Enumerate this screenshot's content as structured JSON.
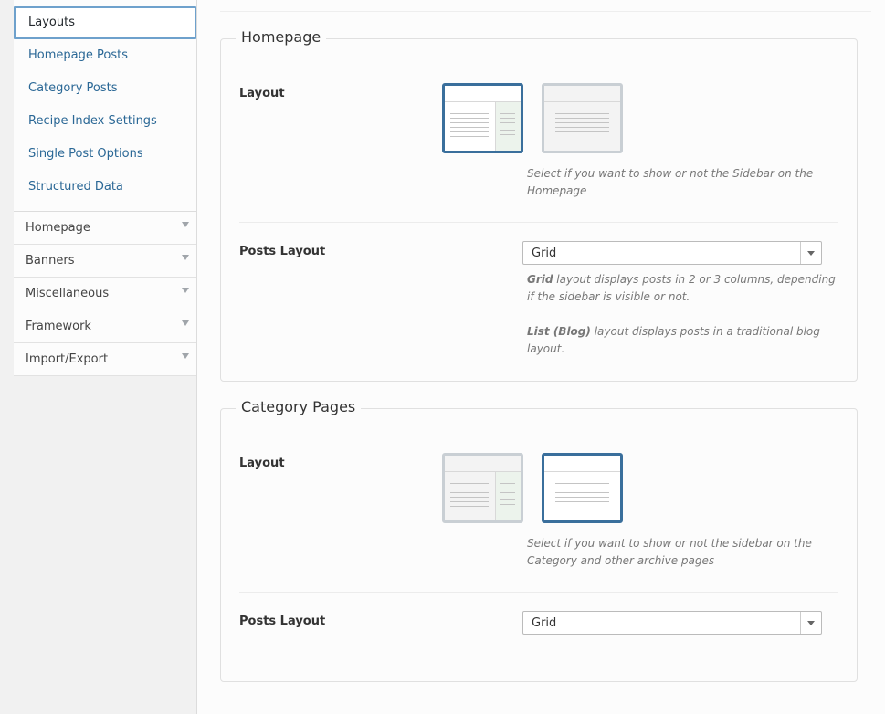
{
  "sidebar": {
    "sub_items": [
      "Layouts",
      "Homepage Posts",
      "Category Posts",
      "Recipe Index Settings",
      "Single Post Options",
      "Structured Data"
    ],
    "groups": [
      "Homepage",
      "Banners",
      "Miscellaneous",
      "Framework",
      "Import/Export"
    ]
  },
  "homepage": {
    "title": "Homepage",
    "layout_label": "Layout",
    "layout_help": "Select if you want to show or not the Sidebar on the Homepage",
    "layout_selected": "with-sidebar",
    "posts_layout_label": "Posts Layout",
    "posts_layout_value": "Grid",
    "grid_help_bold": "Grid",
    "grid_help_text": " layout displays posts in 2 or 3 columns, depending if the sidebar is visible or not.",
    "list_help_bold": "List (Blog)",
    "list_help_text": " layout displays posts in a traditional blog layout."
  },
  "category": {
    "title": "Category Pages",
    "layout_label": "Layout",
    "layout_help": "Select if you want to show or not the sidebar on the Category and other archive pages",
    "layout_selected": "no-sidebar",
    "posts_layout_label": "Posts Layout",
    "posts_layout_value": "Grid"
  },
  "colors": {
    "accent": "#3a6f9c",
    "link": "#2b6896"
  }
}
